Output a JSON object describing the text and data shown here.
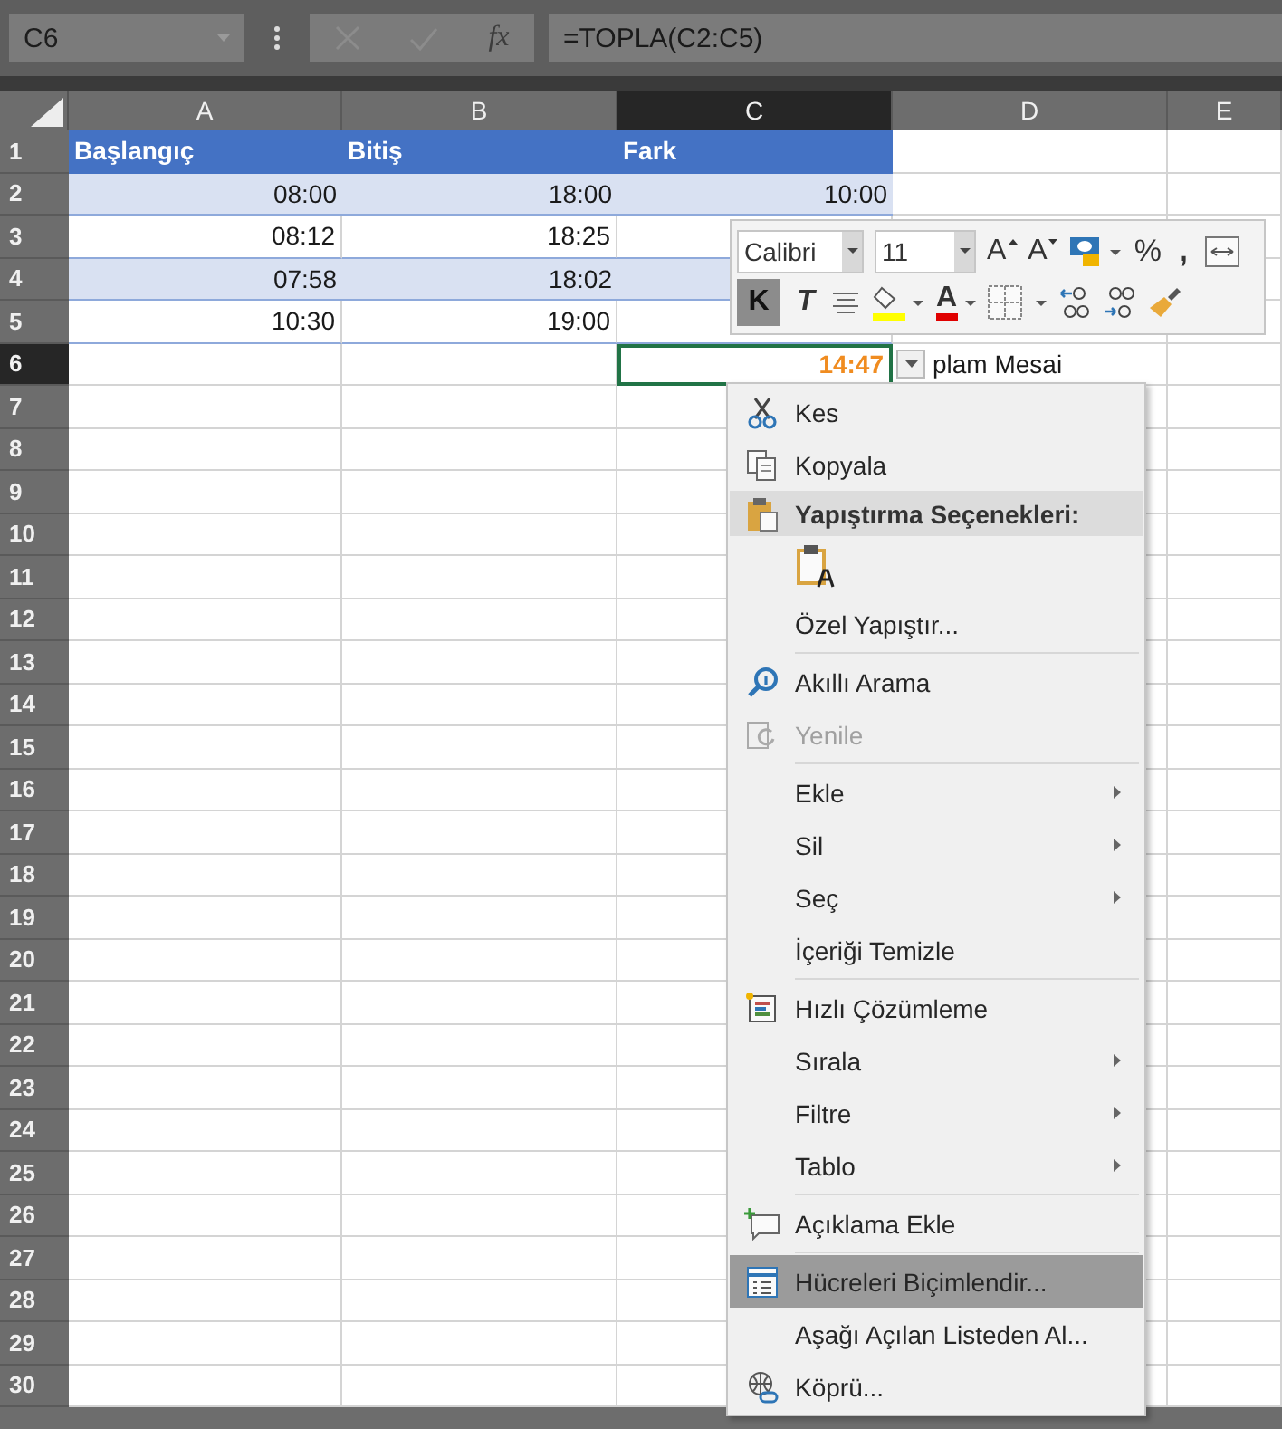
{
  "formula_bar": {
    "name_box": "C6",
    "fx_label": "fx",
    "formula": "=TOPLA(C2:C5)"
  },
  "columns": [
    {
      "label": "A",
      "selected": false
    },
    {
      "label": "B",
      "selected": false
    },
    {
      "label": "C",
      "selected": true
    },
    {
      "label": "D",
      "selected": false
    },
    {
      "label": "E",
      "selected": false
    }
  ],
  "rows": [
    {
      "number": "1",
      "selected": false,
      "kind": "table-header",
      "cells": {
        "A": "Başlangıç",
        "B": "Bitiş",
        "C": "Fark"
      }
    },
    {
      "number": "2",
      "selected": false,
      "kind": "band",
      "cells": {
        "A": "08:00",
        "B": "18:00",
        "C": "10:00"
      }
    },
    {
      "number": "3",
      "selected": false,
      "kind": "table-row",
      "cells": {
        "A": "08:12",
        "B": "18:25"
      }
    },
    {
      "number": "4",
      "selected": false,
      "kind": "band",
      "cells": {
        "A": "07:58",
        "B": "18:02"
      }
    },
    {
      "number": "5",
      "selected": false,
      "kind": "table-row",
      "cells": {
        "A": "10:30",
        "B": "19:00"
      }
    },
    {
      "number": "6",
      "selected": true,
      "kind": "total",
      "cells": {
        "C": "14:47",
        "D": "plam Mesai"
      }
    },
    {
      "number": "7",
      "selected": false,
      "kind": "plain"
    },
    {
      "number": "8",
      "selected": false,
      "kind": "plain"
    },
    {
      "number": "9",
      "selected": false,
      "kind": "plain"
    },
    {
      "number": "10",
      "selected": false,
      "kind": "plain"
    },
    {
      "number": "11",
      "selected": false,
      "kind": "plain"
    },
    {
      "number": "12",
      "selected": false,
      "kind": "plain"
    },
    {
      "number": "13",
      "selected": false,
      "kind": "plain"
    },
    {
      "number": "14",
      "selected": false,
      "kind": "plain"
    },
    {
      "number": "15",
      "selected": false,
      "kind": "plain"
    },
    {
      "number": "16",
      "selected": false,
      "kind": "plain"
    },
    {
      "number": "17",
      "selected": false,
      "kind": "plain"
    },
    {
      "number": "18",
      "selected": false,
      "kind": "plain"
    },
    {
      "number": "19",
      "selected": false,
      "kind": "plain"
    },
    {
      "number": "20",
      "selected": false,
      "kind": "plain"
    },
    {
      "number": "21",
      "selected": false,
      "kind": "plain"
    },
    {
      "number": "22",
      "selected": false,
      "kind": "plain"
    },
    {
      "number": "23",
      "selected": false,
      "kind": "plain"
    },
    {
      "number": "24",
      "selected": false,
      "kind": "plain"
    },
    {
      "number": "25",
      "selected": false,
      "kind": "plain"
    },
    {
      "number": "26",
      "selected": false,
      "kind": "plain"
    },
    {
      "number": "27",
      "selected": false,
      "kind": "plain"
    },
    {
      "number": "28",
      "selected": false,
      "kind": "plain"
    },
    {
      "number": "29",
      "selected": false,
      "kind": "plain"
    },
    {
      "number": "30",
      "selected": false,
      "kind": "plain"
    }
  ],
  "cell_dropdown": true,
  "mini_toolbar": {
    "font": "Calibri",
    "size": "11",
    "grow_label": "A",
    "shrink_label": "A",
    "percent_label": "%",
    "comma_label": ",",
    "bold_label": "K",
    "bold": true,
    "italic_label": "T",
    "font_color_label": "A"
  },
  "context_menu": [
    {
      "kind": "item",
      "label": "Kes",
      "selected": false,
      "disabled": false,
      "submenu": false
    },
    {
      "kind": "item",
      "label": "Kopyala",
      "selected": false,
      "disabled": false,
      "submenu": false
    },
    {
      "kind": "header",
      "label": "Yapıştırma Seçenekleri:"
    },
    {
      "kind": "paste-option"
    },
    {
      "kind": "item",
      "label": "Özel Yapıştır...",
      "selected": false,
      "disabled": false,
      "submenu": false
    },
    {
      "kind": "separator"
    },
    {
      "kind": "item",
      "label": "Akıllı Arama",
      "selected": false,
      "disabled": false,
      "submenu": false
    },
    {
      "kind": "item",
      "label": "Yenile",
      "selected": false,
      "disabled": true,
      "submenu": false
    },
    {
      "kind": "separator"
    },
    {
      "kind": "item",
      "label": "Ekle",
      "selected": false,
      "disabled": false,
      "submenu": true
    },
    {
      "kind": "item",
      "label": "Sil",
      "selected": false,
      "disabled": false,
      "submenu": true
    },
    {
      "kind": "item",
      "label": "Seç",
      "selected": false,
      "disabled": false,
      "submenu": true
    },
    {
      "kind": "item",
      "label": "İçeriği Temizle",
      "selected": false,
      "disabled": false,
      "submenu": false
    },
    {
      "kind": "separator"
    },
    {
      "kind": "item",
      "label": "Hızlı Çözümleme",
      "selected": false,
      "disabled": false,
      "submenu": false
    },
    {
      "kind": "item",
      "label": "Sırala",
      "selected": false,
      "disabled": false,
      "submenu": true
    },
    {
      "kind": "item",
      "label": "Filtre",
      "selected": false,
      "disabled": false,
      "submenu": true
    },
    {
      "kind": "item",
      "label": "Tablo",
      "selected": false,
      "disabled": false,
      "submenu": true
    },
    {
      "kind": "separator"
    },
    {
      "kind": "item",
      "label": "Açıklama Ekle",
      "selected": false,
      "disabled": false,
      "submenu": false
    },
    {
      "kind": "separator"
    },
    {
      "kind": "item",
      "label": "Hücreleri Biçimlendir...",
      "selected": true,
      "disabled": false,
      "submenu": false
    },
    {
      "kind": "item",
      "label": "Aşağı Açılan Listeden Al...",
      "selected": false,
      "disabled": false,
      "submenu": false
    },
    {
      "kind": "item",
      "label": "Köprü...",
      "selected": false,
      "disabled": false,
      "submenu": false
    }
  ]
}
